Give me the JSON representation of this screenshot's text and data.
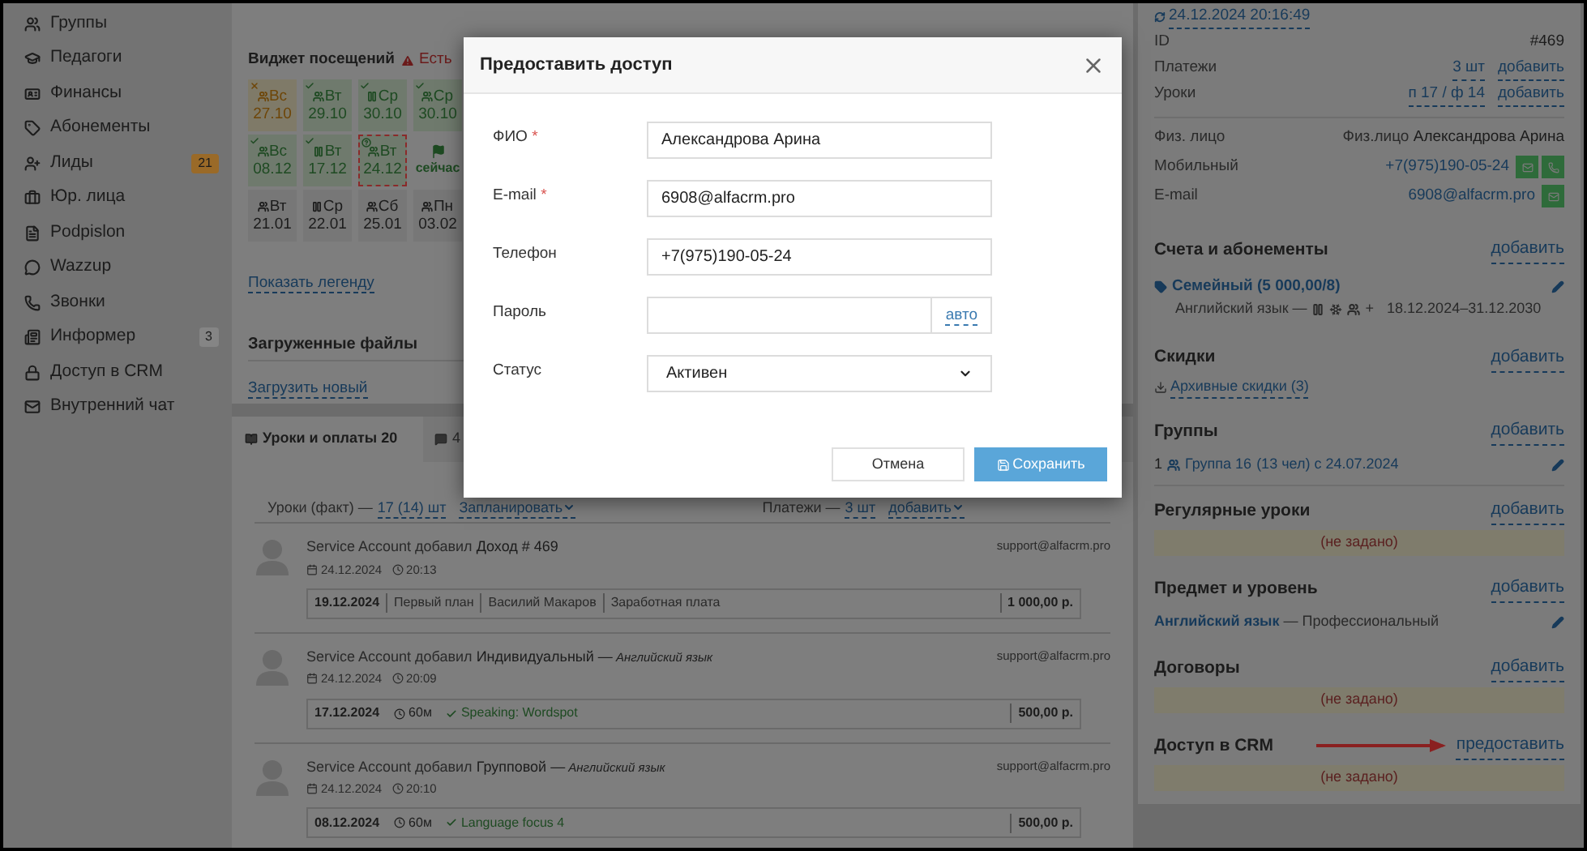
{
  "sidebar": {
    "items": [
      {
        "label": "Группы"
      },
      {
        "label": "Педагоги"
      },
      {
        "label": "Финансы"
      },
      {
        "label": "Абонементы"
      },
      {
        "label": "Лиды",
        "badge": "21",
        "color": "#9a6a28"
      },
      {
        "label": "Юр. лица"
      },
      {
        "label": "Podpislon"
      },
      {
        "label": "Wazzup"
      },
      {
        "label": "Звонки"
      },
      {
        "label": "Информер",
        "badge": "3",
        "color": "#858585"
      },
      {
        "label": "Доступ в CRM"
      },
      {
        "label": "Внутренний чат"
      }
    ]
  },
  "attendance_widget": {
    "title": "Виджет посещений",
    "warning": "Есть",
    "rows": [
      {
        "cells": [
          {
            "kind": "missed",
            "individual": false,
            "day": "Вс",
            "date": "27.10"
          },
          {
            "kind": "attended",
            "individual": false,
            "day": "Вт",
            "date": "29.10"
          },
          {
            "kind": "attended",
            "individual": true,
            "day": "Ср",
            "date": "30.10"
          },
          {
            "kind": "attended",
            "individual": false,
            "day": "Ср",
            "date": "30.10"
          }
        ]
      },
      {
        "cells": [
          {
            "kind": "attended",
            "individual": false,
            "day": "Вс",
            "date": "08.12"
          },
          {
            "kind": "attended",
            "individual": true,
            "day": "Вт",
            "date": "17.12"
          },
          {
            "kind": "unknown",
            "individual": false,
            "day": "Вт",
            "date": "24.12"
          },
          {
            "kind": "now",
            "label": "сейчас"
          }
        ]
      },
      {
        "cells": [
          {
            "kind": "planned",
            "individual": false,
            "day": "Вт",
            "date": "21.01"
          },
          {
            "kind": "planned",
            "individual": true,
            "day": "Ср",
            "date": "22.01"
          },
          {
            "kind": "planned",
            "individual": false,
            "day": "Сб",
            "date": "25.01"
          },
          {
            "kind": "planned",
            "individual": false,
            "day": "Пн",
            "date": "03.02"
          }
        ]
      }
    ],
    "legend_link": "Показать легенду"
  },
  "files": {
    "title": "Загруженные файлы",
    "upload_link": "Загрузить новый"
  },
  "tabs": [
    {
      "label": "Уроки и оплаты 20",
      "selected": true
    },
    {
      "label": "4",
      "selected": false
    }
  ],
  "lessons_bar": {
    "lessons_label": "Уроки (факт) —",
    "lessons_count": "17 (14) шт",
    "plan_link": "Запланировать",
    "payments_label": "Платежи —",
    "payments_count": "3 шт",
    "add_link": "добавить"
  },
  "feed": [
    {
      "actor": "Service Account добавил",
      "object": "Доход # 469",
      "date": "24.12.2024",
      "time": "20:13",
      "email": "support@alfacrm.pro",
      "detail": {
        "kind": "payment",
        "date": "19.12.2024",
        "parts": [
          "Первый план",
          "Василий Макаров",
          "Заработная плата"
        ],
        "amount": "1 000,00 р."
      }
    },
    {
      "actor": "Service Account добавил",
      "object": "Индивидуальный —",
      "subject": "Английский язык",
      "date": "24.12.2024",
      "time": "20:09",
      "email": "support@alfacrm.pro",
      "detail": {
        "kind": "lesson",
        "date": "17.12.2024",
        "duration": "60м",
        "topic": "Speaking: Wordspot",
        "amount": "500,00 р."
      }
    },
    {
      "actor": "Service Account добавил",
      "object": "Групповой —",
      "subject": "Английский язык",
      "date": "24.12.2024",
      "time": "20:10",
      "email": "support@alfacrm.pro",
      "detail": {
        "kind": "lesson",
        "date": "08.12.2024",
        "duration": "60м",
        "topic": "Language focus 4",
        "amount": "500,00 р."
      }
    }
  ],
  "modal": {
    "title": "Предоставить доступ",
    "fields": [
      {
        "kind": "text",
        "label": "ФИО",
        "mark": "*",
        "value": "Александрова Арина"
      },
      {
        "kind": "text",
        "label": "E-mail",
        "mark": "*",
        "value": "6908@alfacrm.pro"
      },
      {
        "kind": "text",
        "label": "Телефон",
        "value": "+7(975)190-05-24"
      },
      {
        "kind": "password",
        "label": "Пароль",
        "addon": "авто"
      },
      {
        "kind": "select",
        "label": "Статус",
        "value": "Активен"
      }
    ],
    "cancel": "Отмена",
    "save": "Сохранить"
  },
  "customer": {
    "synced": "24.12.2024 20:16:49",
    "stats": [
      {
        "label": "ID",
        "value": "#469"
      },
      {
        "label": "Платежи",
        "link": "3 шт",
        "action": "добавить"
      },
      {
        "label": "Уроки",
        "link": "п 17 / ф 14",
        "action": "добавить"
      }
    ],
    "contacts": [
      {
        "kind": "person",
        "label": "Физ. лицо",
        "prefix": "Физ.лицо",
        "value": "Александрова Арина"
      },
      {
        "kind": "phone",
        "label": "Мобильный",
        "value": "+7(975)190-05-24"
      },
      {
        "kind": "email",
        "label": "E-mail",
        "value": "6908@alfacrm.pro"
      }
    ],
    "sections": [
      {
        "kind": "subscription",
        "title": "Счета и абонементы",
        "action": "добавить",
        "name": "Семейный (5 000,00/8)",
        "subject": "Английский язык —",
        "extra": "+",
        "period": "18.12.2024–31.12.2030"
      },
      {
        "kind": "discounts",
        "title": "Скидки",
        "action": "добавить",
        "link": "Архивные скидки (3)"
      },
      {
        "kind": "groups",
        "title": "Группы",
        "action": "добавить",
        "count": "1",
        "group": "Группа 16",
        "info": "(13 чел) с 24.07.2024"
      },
      {
        "kind": "empty",
        "title": "Регулярные уроки",
        "action": "добавить",
        "empty_text": "(не задано)"
      },
      {
        "kind": "subject",
        "title": "Предмет и уровень",
        "action": "добавить",
        "subject": "Английский язык",
        "level": "— Профессиональный"
      },
      {
        "kind": "empty",
        "title": "Договоры",
        "action": "добавить",
        "empty_text": "(не задано)"
      },
      {
        "kind": "empty",
        "title": "Доступ в CRM",
        "action": "предоставить",
        "empty_text": "(не задано)",
        "highlight": true
      }
    ]
  }
}
